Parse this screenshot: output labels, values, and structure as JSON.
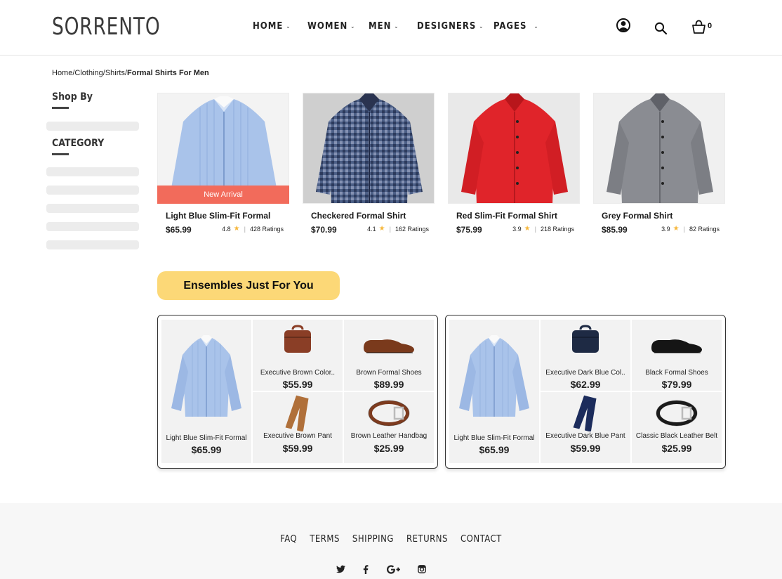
{
  "brand": {
    "logo_text": "SORRENTO"
  },
  "nav": {
    "items": [
      {
        "label": "HOME"
      },
      {
        "label": "WOMEN"
      },
      {
        "label": "MEN"
      },
      {
        "label": "DESIGNERS"
      },
      {
        "label": "PAGES"
      }
    ],
    "chevron": "⌄",
    "cart_count": "0",
    "icons": [
      "user-icon",
      "search-icon",
      "cart-icon"
    ]
  },
  "breadcrumb": {
    "items": [
      "Home",
      "Clothing",
      "Shirts"
    ],
    "separator": "/",
    "current": "Formal Shirts For Men"
  },
  "sidebar": {
    "shop_by": "Shop By",
    "category": "CATEGORY"
  },
  "products": [
    {
      "name": "Light Blue Slim-Fit Formal",
      "price": "$65.99",
      "rating": "4.8",
      "ratings_count": "428 Ratings",
      "badge": "New Arrival",
      "color": "#a9c3ea"
    },
    {
      "name": "Checkered Formal Shirt",
      "price": "$70.99",
      "rating": "4.1",
      "ratings_count": "162 Ratings",
      "color": "#4c5f86"
    },
    {
      "name": "Red Slim-Fit Formal Shirt",
      "price": "$75.99",
      "rating": "3.9",
      "ratings_count": "218 Ratings",
      "color": "#e0242a"
    },
    {
      "name": "Grey Formal Shirt",
      "price": "$85.99",
      "rating": "3.9",
      "ratings_count": "82 Ratings",
      "color": "#8a8c92"
    }
  ],
  "ensembles": {
    "button_label": "Ensembles Just For You",
    "sets": [
      {
        "main": {
          "label": "Light Blue Slim-Fit Formal",
          "price": "$65.99"
        },
        "items": [
          {
            "label": "Executive Brown Color..",
            "price": "$55.99",
            "icon": "briefcase-icon",
            "color": "#8a3e26"
          },
          {
            "label": "Brown Formal Shoes",
            "price": "$89.99",
            "icon": "shoe-icon",
            "color": "#7a3a1c"
          },
          {
            "label": "Executive Brown Pant",
            "price": "$59.99",
            "icon": "pant-icon",
            "color": "#b0703a"
          },
          {
            "label": "Brown Leather Handbag",
            "price": "$25.99",
            "icon": "belt-icon",
            "color": "#7d3b1f"
          }
        ]
      },
      {
        "main": {
          "label": "Light Blue Slim-Fit Formal",
          "price": "$65.99"
        },
        "items": [
          {
            "label": "Executive Dark Blue Col..",
            "price": "$62.99",
            "icon": "briefcase-icon",
            "color": "#1e2a44"
          },
          {
            "label": "Black Formal Shoes",
            "price": "$79.99",
            "icon": "shoe-icon",
            "color": "#151515"
          },
          {
            "label": "Executive Dark Blue Pant",
            "price": "$59.99",
            "icon": "pant-icon",
            "color": "#1c2c5c"
          },
          {
            "label": "Classic Black Leather Belt",
            "price": "$25.99",
            "icon": "belt-icon",
            "color": "#1b1b1b"
          }
        ]
      }
    ]
  },
  "footer": {
    "links": [
      "FAQ",
      "TERMS",
      "SHIPPING",
      "RETURNS",
      "CONTACT"
    ],
    "social": [
      "twitter-icon",
      "facebook-icon",
      "google-plus-icon",
      "instagram-icon"
    ]
  }
}
